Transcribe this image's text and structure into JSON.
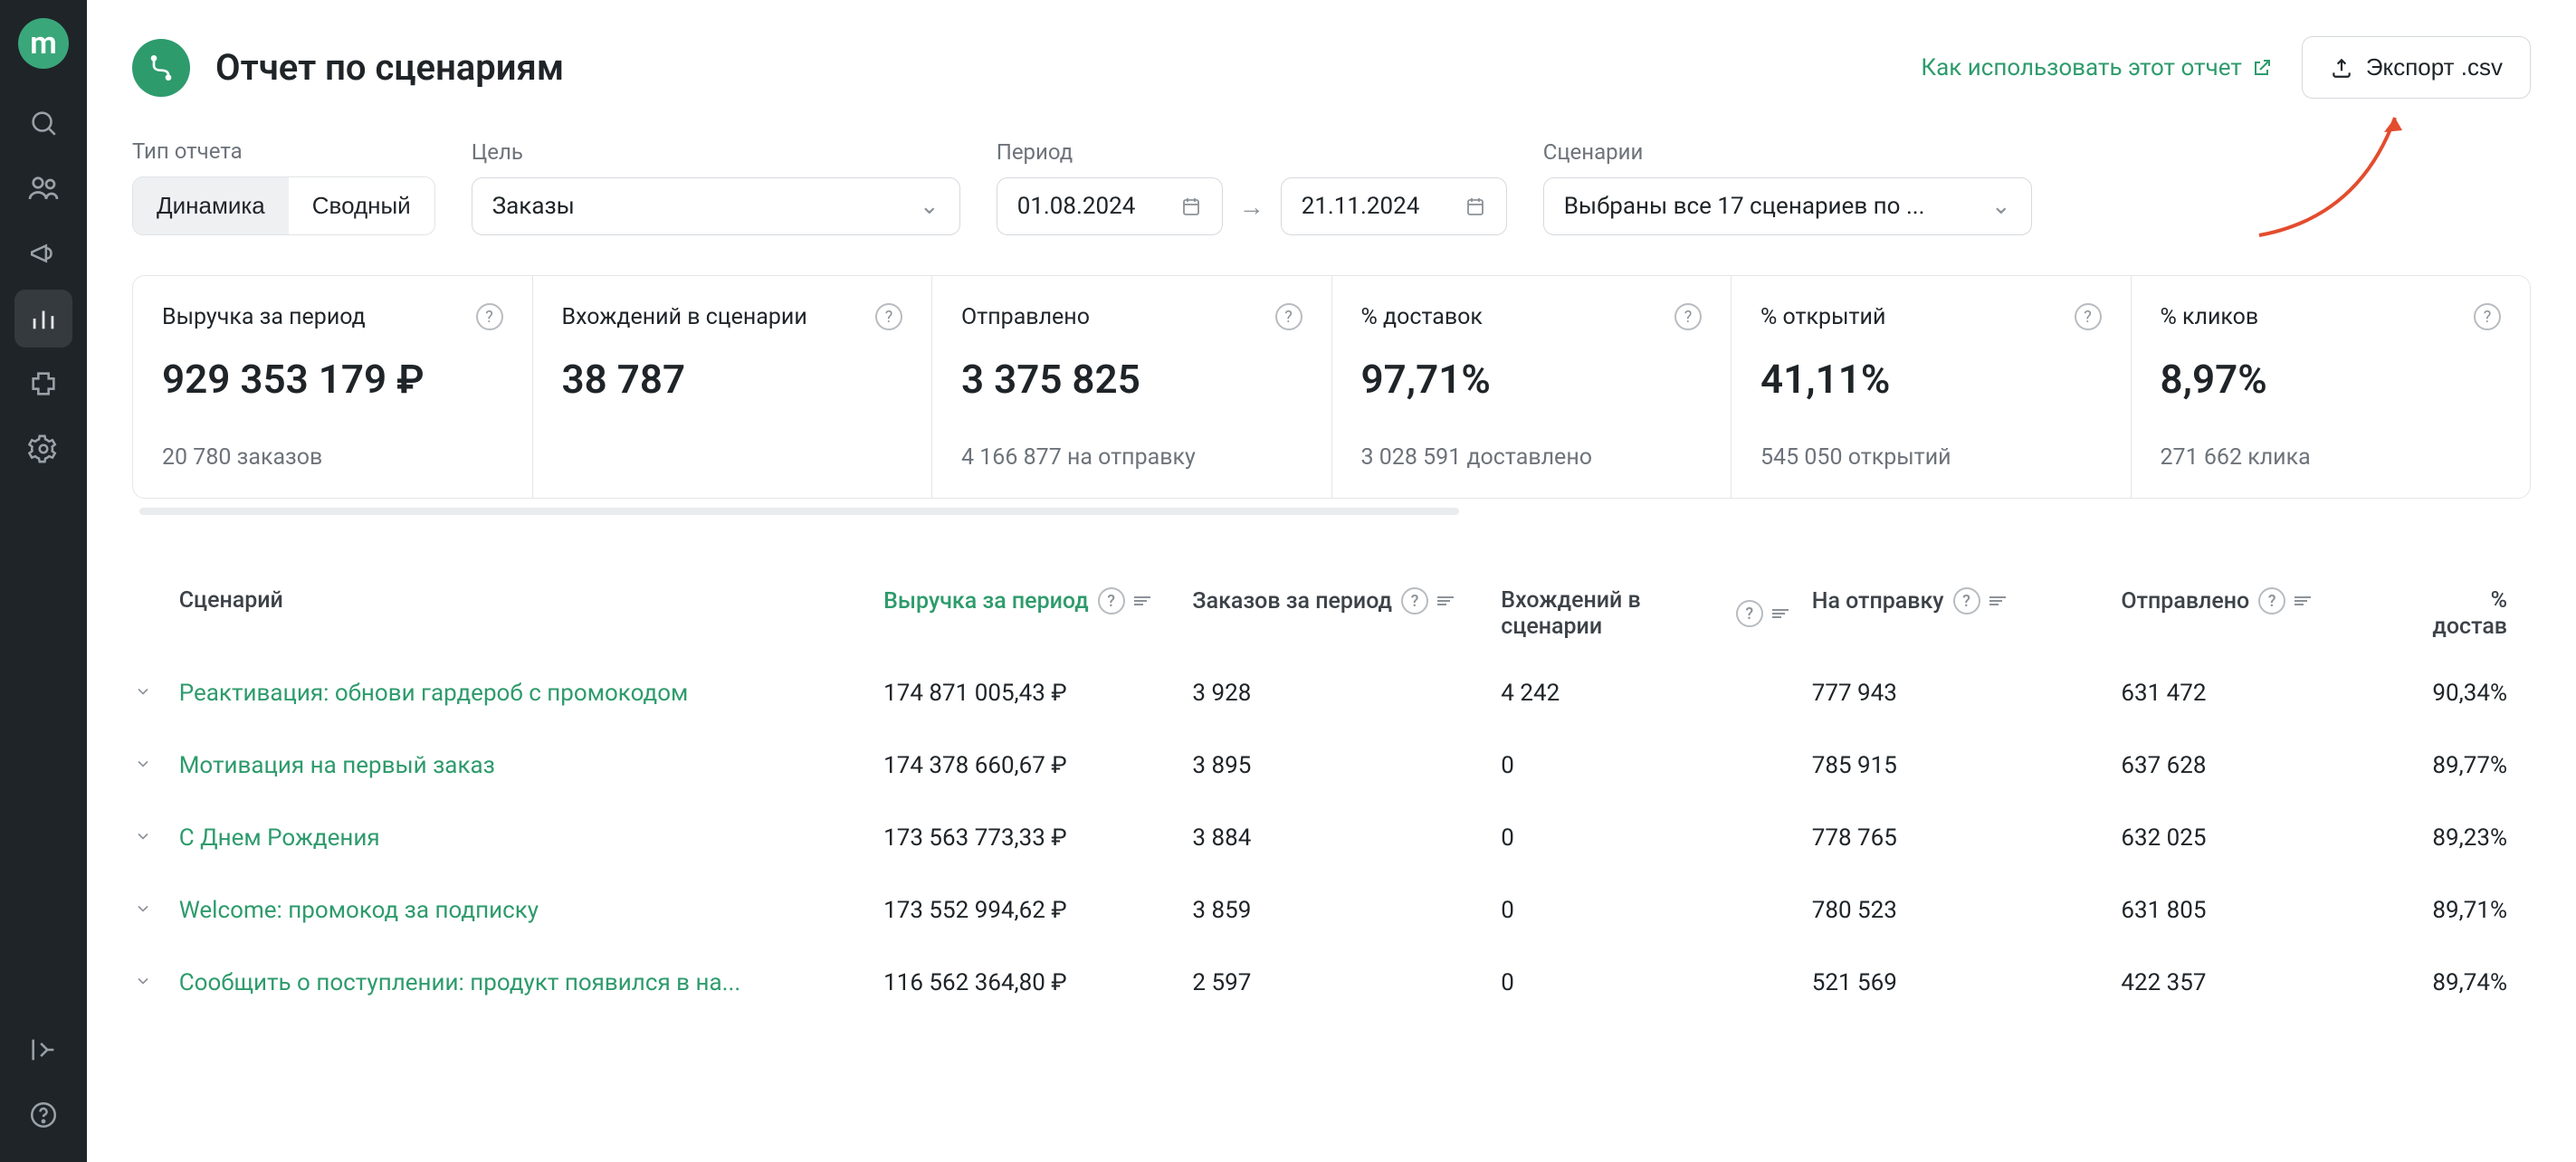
{
  "app": {
    "logo_letter": "m"
  },
  "header": {
    "title": "Отчет по сценариям",
    "help_link": "Как использовать этот отчет",
    "export_btn": "Экспорт .csv"
  },
  "filters": {
    "type_label": "Тип отчета",
    "type_options": {
      "dynamics": "Динамика",
      "summary": "Сводный"
    },
    "goal_label": "Цель",
    "goal_value": "Заказы",
    "period_label": "Период",
    "date_from": "01.08.2024",
    "date_to": "21.11.2024",
    "scenarios_label": "Сценарии",
    "scenarios_value": "Выбраны все 17 сценариев по ..."
  },
  "metrics": [
    {
      "label": "Выручка за период",
      "value": "929 353 179 ₽",
      "sub": "20 780 заказов"
    },
    {
      "label": "Вхождений в сценарии",
      "value": "38 787",
      "sub": ""
    },
    {
      "label": "Отправлено",
      "value": "3 375 825",
      "sub": "4 166 877 на отправку"
    },
    {
      "label": "% доставок",
      "value": "97,71%",
      "sub": "3 028 591 доставлено"
    },
    {
      "label": "% открытий",
      "value": "41,11%",
      "sub": "545 050 открытий"
    },
    {
      "label": "% кликов",
      "value": "8,97%",
      "sub": "271 662 клика"
    }
  ],
  "table": {
    "headers": {
      "scenario": "Сценарий",
      "revenue": "Выручка за период",
      "orders": "Заказов за период",
      "entries": "Вхождений в сценарии",
      "to_send": "На отправку",
      "sent": "Отправлено",
      "delivered_pct": "% достав"
    },
    "rows": [
      {
        "name": "Реактивация: обнови гардероб с промокодом",
        "revenue": "174 871 005,43 ₽",
        "orders": "3 928",
        "entries": "4 242",
        "to_send": "777 943",
        "sent": "631 472",
        "pct": "90,34%"
      },
      {
        "name": "Мотивация на первый заказ",
        "revenue": "174 378 660,67 ₽",
        "orders": "3 895",
        "entries": "0",
        "to_send": "785 915",
        "sent": "637 628",
        "pct": "89,77%"
      },
      {
        "name": "С Днем Рождения",
        "revenue": "173 563 773,33 ₽",
        "orders": "3 884",
        "entries": "0",
        "to_send": "778 765",
        "sent": "632 025",
        "pct": "89,23%"
      },
      {
        "name": "Welcome: промокод за подписку",
        "revenue": "173 552 994,62 ₽",
        "orders": "3 859",
        "entries": "0",
        "to_send": "780 523",
        "sent": "631 805",
        "pct": "89,71%"
      },
      {
        "name": "Сообщить о поступлении: продукт появился в на...",
        "revenue": "116 562 364,80 ₽",
        "orders": "2 597",
        "entries": "0",
        "to_send": "521 569",
        "sent": "422 357",
        "pct": "89,74%"
      }
    ]
  }
}
